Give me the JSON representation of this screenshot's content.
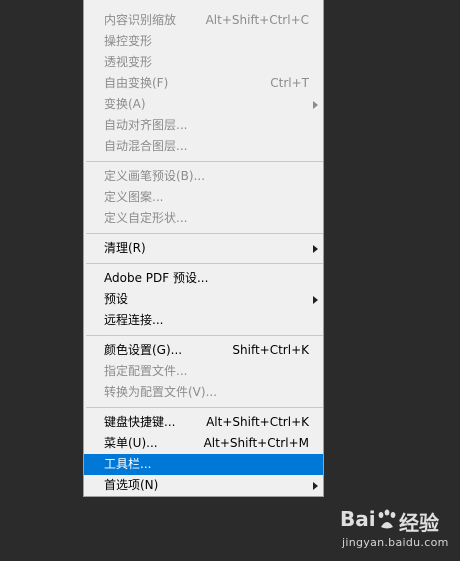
{
  "menu": {
    "groups": [
      [
        {
          "label": "内容识别缩放",
          "shortcut": "Alt+Shift+Ctrl+C",
          "enabled": false,
          "submenu": false
        },
        {
          "label": "操控变形",
          "shortcut": "",
          "enabled": false,
          "submenu": false
        },
        {
          "label": "透视变形",
          "shortcut": "",
          "enabled": false,
          "submenu": false
        },
        {
          "label": "自由变换(F)",
          "shortcut": "Ctrl+T",
          "enabled": false,
          "submenu": false
        },
        {
          "label": "变换(A)",
          "shortcut": "",
          "enabled": false,
          "submenu": true
        },
        {
          "label": "自动对齐图层...",
          "shortcut": "",
          "enabled": false,
          "submenu": false
        },
        {
          "label": "自动混合图层...",
          "shortcut": "",
          "enabled": false,
          "submenu": false
        }
      ],
      [
        {
          "label": "定义画笔预设(B)...",
          "shortcut": "",
          "enabled": false,
          "submenu": false
        },
        {
          "label": "定义图案...",
          "shortcut": "",
          "enabled": false,
          "submenu": false
        },
        {
          "label": "定义自定形状...",
          "shortcut": "",
          "enabled": false,
          "submenu": false
        }
      ],
      [
        {
          "label": "清理(R)",
          "shortcut": "",
          "enabled": true,
          "submenu": true
        }
      ],
      [
        {
          "label": "Adobe PDF 预设...",
          "shortcut": "",
          "enabled": true,
          "submenu": false
        },
        {
          "label": "预设",
          "shortcut": "",
          "enabled": true,
          "submenu": true
        },
        {
          "label": "远程连接...",
          "shortcut": "",
          "enabled": true,
          "submenu": false
        }
      ],
      [
        {
          "label": "颜色设置(G)...",
          "shortcut": "Shift+Ctrl+K",
          "enabled": true,
          "submenu": false
        },
        {
          "label": "指定配置文件...",
          "shortcut": "",
          "enabled": false,
          "submenu": false
        },
        {
          "label": "转换为配置文件(V)...",
          "shortcut": "",
          "enabled": false,
          "submenu": false
        }
      ],
      [
        {
          "label": "键盘快捷键...",
          "shortcut": "Alt+Shift+Ctrl+K",
          "enabled": true,
          "submenu": false
        },
        {
          "label": "菜单(U)...",
          "shortcut": "Alt+Shift+Ctrl+M",
          "enabled": true,
          "submenu": false
        },
        {
          "label": "工具栏...",
          "shortcut": "",
          "enabled": true,
          "submenu": false,
          "highlighted": true
        },
        {
          "label": "首选项(N)",
          "shortcut": "",
          "enabled": true,
          "submenu": true
        }
      ]
    ]
  },
  "watermark": {
    "brand": "Bai",
    "brand_suffix": "经验",
    "url": "jingyan.baidu.com"
  },
  "colors": {
    "background": "#2b2b2b",
    "menu_bg": "#f0f0f0",
    "highlight": "#0078d7",
    "disabled_text": "#8c8c8c"
  }
}
